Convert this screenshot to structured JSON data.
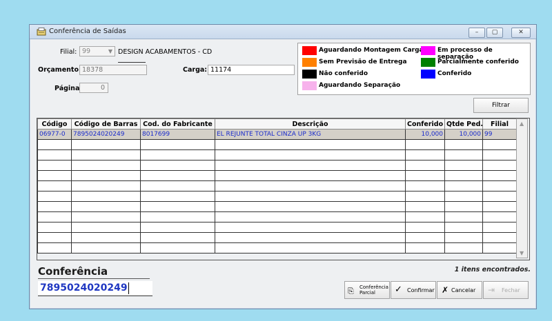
{
  "window": {
    "title": "Conferência de Saídas",
    "controls": {
      "minimize": "–",
      "maximize": "▢",
      "close": "✕"
    }
  },
  "form": {
    "filial_label": "Filial:",
    "filial_value": "99",
    "filial_name": "DESIGN ACABAMENTOS - CD",
    "orcamento_label": "Orçamento:",
    "orcamento_value": "18378",
    "carga_label": "Carga:",
    "carga_value": "11174",
    "pagina_label": "Página",
    "pagina_value": "0"
  },
  "legend": {
    "items": [
      {
        "label": "Aguardando Montagem Carga",
        "color": "#ff0000"
      },
      {
        "label": "Sem Previsão de Entrega",
        "color": "#ff8000"
      },
      {
        "label": "Não conferido",
        "color": "#000000"
      },
      {
        "label": "Aguardando Separação",
        "color": "#f7b2ec"
      },
      {
        "label": "Em processo de separação",
        "color": "#ff00ff"
      },
      {
        "label": "Parcialmente conferido",
        "color": "#008000"
      },
      {
        "label": "Conferido",
        "color": "#0000ff"
      }
    ]
  },
  "filter_button": "Filtrar",
  "grid": {
    "columns": [
      "Código",
      "Código de Barras",
      "Cod. do Fabricante",
      "Descrição",
      "Conferido",
      "Qtde Ped.",
      "Filial"
    ],
    "rows": [
      [
        "06977-0",
        "7895024020249",
        "8017699",
        "EL REJUNTE TOTAL CINZA UP 3KG",
        "10,000",
        "10,000",
        "99"
      ]
    ]
  },
  "conferencia": {
    "title": "Conferência",
    "input_value": "7895024020249"
  },
  "status": {
    "items_found": "1 itens encontrados."
  },
  "actions": {
    "partial_line1": "Conferência",
    "partial_line2": "Parcial",
    "confirm": "Confirmar",
    "cancel": "Cancelar",
    "close": "Fechar"
  }
}
